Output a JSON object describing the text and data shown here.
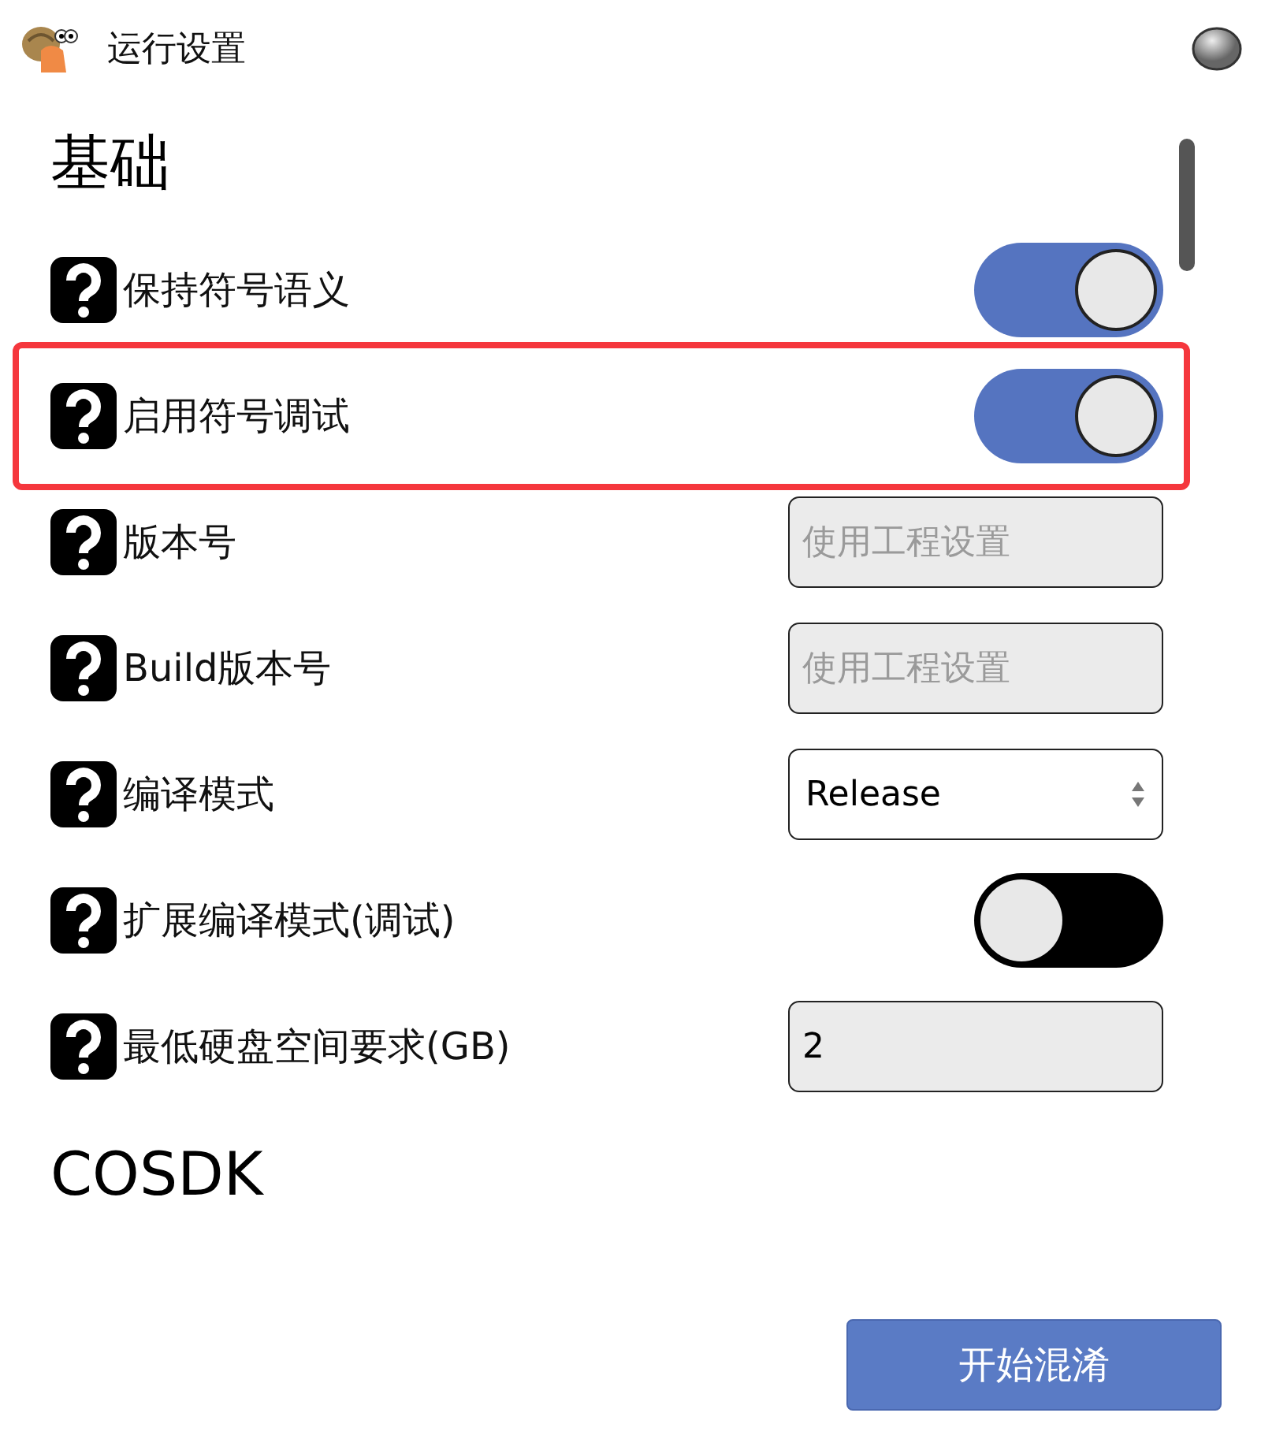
{
  "window": {
    "title": "运行设置"
  },
  "sections": [
    {
      "title": "基础",
      "rows": [
        {
          "kind": "toggle",
          "label": "保持符号语义",
          "on": true,
          "highlighted": false
        },
        {
          "kind": "toggle",
          "label": "启用符号调试",
          "on": true,
          "highlighted": true
        },
        {
          "kind": "text",
          "label": "版本号",
          "placeholder": "使用工程设置",
          "highlighted": false
        },
        {
          "kind": "text",
          "label": "Build版本号",
          "placeholder": "使用工程设置",
          "highlighted": false
        },
        {
          "kind": "select",
          "label": "编译模式",
          "value": "Release",
          "highlighted": false
        },
        {
          "kind": "toggle",
          "label": "扩展编译模式(调试)",
          "on": false,
          "highlighted": false
        },
        {
          "kind": "text",
          "label": "最低硬盘空间要求(GB)",
          "value": "2",
          "highlighted": false
        }
      ]
    },
    {
      "title": "COSDK"
    }
  ],
  "primary_button": "开始混淆"
}
